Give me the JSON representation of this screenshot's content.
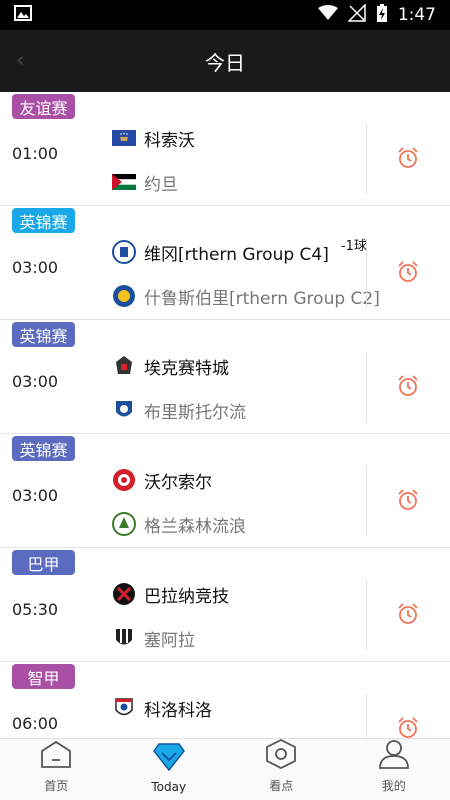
{
  "status_bar": {
    "time": "1:47"
  },
  "header": {
    "title": "今日"
  },
  "colors": {
    "accent_purple": "#5b6bbf",
    "accent_cyan": "#1aa9e8",
    "accent_magenta": "#a94fa6",
    "alarm": "#f0735a"
  },
  "matches": [
    {
      "league": "友谊赛",
      "league_color": "#a94fa6",
      "time": "01:00",
      "home": "科索沃",
      "away": "约旦",
      "handicap": ""
    },
    {
      "league": "英锦赛",
      "league_color": "#1aa9e8",
      "time": "03:00",
      "home": "维冈[rthern Group C4]",
      "away": "什鲁斯伯里[rthern Group C2]",
      "handicap": "-1球"
    },
    {
      "league": "英锦赛",
      "league_color": "#5b6bbf",
      "time": "03:00",
      "home": "埃克赛特城",
      "away": "布里斯托尔流",
      "handicap": ""
    },
    {
      "league": "英锦赛",
      "league_color": "#5b6bbf",
      "time": "03:00",
      "home": "沃尔索尔",
      "away": "格兰森林流浪",
      "handicap": ""
    },
    {
      "league": "巴甲",
      "league_color": "#5b6bbf",
      "time": "05:30",
      "home": "巴拉纳竞技",
      "away": "塞阿拉",
      "handicap": ""
    },
    {
      "league": "智甲",
      "league_color": "#a94fa6",
      "time": "06:00",
      "home": "科洛科洛",
      "away": "",
      "handicap": ""
    }
  ],
  "tabbar": {
    "items": [
      {
        "label": "首页",
        "icon": "home-icon"
      },
      {
        "label": "Today",
        "icon": "diamond-icon"
      },
      {
        "label": "看点",
        "icon": "hexagon-icon"
      },
      {
        "label": "我的",
        "icon": "person-icon"
      }
    ],
    "active_index": 1
  }
}
